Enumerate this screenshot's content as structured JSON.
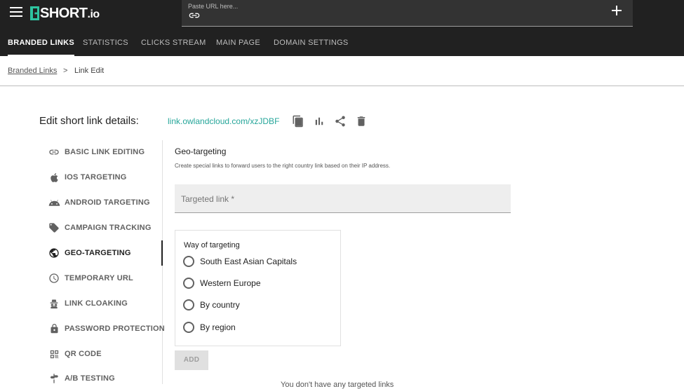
{
  "app": {
    "logo_text": "SHORT",
    "logo_suffix": ".io"
  },
  "url_bar": {
    "placeholder": "Paste URL here..."
  },
  "nav": {
    "tabs": [
      {
        "label": "BRANDED LINKS",
        "active": true
      },
      {
        "label": "STATISTICS",
        "active": false
      },
      {
        "label": "CLICKS STREAM",
        "active": false
      },
      {
        "label": "MAIN PAGE",
        "active": false
      },
      {
        "label": "DOMAIN SETTINGS",
        "active": false
      }
    ]
  },
  "breadcrumb": {
    "parent": "Branded Links",
    "separator": ">",
    "current": "Link Edit"
  },
  "header": {
    "title": "Edit short link details:",
    "short_link": "link.owlandcloud.com/xzJDBF",
    "icons": [
      "copy-icon",
      "stats-icon",
      "share-icon",
      "delete-icon"
    ]
  },
  "sidebar": {
    "items": [
      {
        "label": "BASIC LINK EDITING",
        "icon": "link-icon",
        "active": false
      },
      {
        "label": "IOS TARGETING",
        "icon": "apple-icon",
        "active": false
      },
      {
        "label": "ANDROID TARGETING",
        "icon": "android-icon",
        "active": false
      },
      {
        "label": "CAMPAIGN TRACKING",
        "icon": "tag-icon",
        "active": false
      },
      {
        "label": "GEO-TARGETING",
        "icon": "globe-icon",
        "active": true
      },
      {
        "label": "TEMPORARY URL",
        "icon": "clock-icon",
        "active": false
      },
      {
        "label": "LINK CLOAKING",
        "icon": "spy-icon",
        "active": false
      },
      {
        "label": "PASSWORD PROTECTION",
        "icon": "lock-icon",
        "active": false
      },
      {
        "label": "QR CODE",
        "icon": "qr-icon",
        "active": false
      },
      {
        "label": "A/B TESTING",
        "icon": "signpost-icon",
        "active": false
      }
    ]
  },
  "geo": {
    "title": "Geo-targeting",
    "description": "Create special links to forward users to the right country link based on their IP address.",
    "targeted_link_label": "Targeted link *",
    "way_title": "Way of targeting",
    "options": [
      "South East Asian Capitals",
      "Western Europe",
      "By country",
      "By region"
    ],
    "add_label": "ADD",
    "empty_note": "You don't have any targeted links"
  },
  "colors": {
    "accent": "#26a69a",
    "topbar": "#212121"
  }
}
